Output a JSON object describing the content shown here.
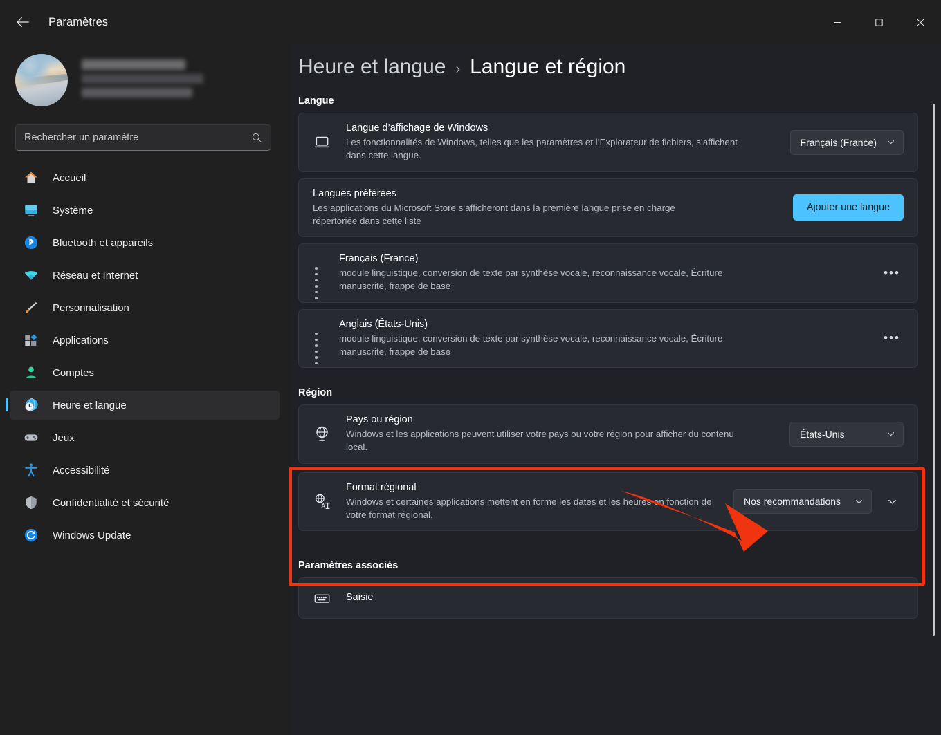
{
  "window": {
    "title": "Paramètres",
    "back_icon": "back-arrow-icon",
    "minimize_label": "—",
    "maximize_label": "□",
    "close_label": "✕"
  },
  "sidebar": {
    "account": {
      "avatar_icon": "user-avatar-image"
    },
    "search": {
      "placeholder": "Rechercher un paramètre",
      "value": "",
      "icon": "search-icon"
    },
    "items": [
      {
        "label": "Accueil",
        "icon": "home-icon",
        "active": false
      },
      {
        "label": "Système",
        "icon": "system-monitor-icon",
        "active": false
      },
      {
        "label": "Bluetooth et appareils",
        "icon": "bluetooth-icon",
        "active": false
      },
      {
        "label": "Réseau et Internet",
        "icon": "wifi-icon",
        "active": false
      },
      {
        "label": "Personnalisation",
        "icon": "paintbrush-icon",
        "active": false
      },
      {
        "label": "Applications",
        "icon": "apps-icon",
        "active": false
      },
      {
        "label": "Comptes",
        "icon": "person-icon",
        "active": false
      },
      {
        "label": "Heure et langue",
        "icon": "clock-globe-icon",
        "active": true
      },
      {
        "label": "Jeux",
        "icon": "gamepad-icon",
        "active": false
      },
      {
        "label": "Accessibilité",
        "icon": "accessibility-icon",
        "active": false
      },
      {
        "label": "Confidentialité et sécurité",
        "icon": "shield-icon",
        "active": false
      },
      {
        "label": "Windows Update",
        "icon": "update-refresh-icon",
        "active": false
      }
    ]
  },
  "breadcrumb": {
    "parent": "Heure et langue",
    "separator": "›",
    "current": "Langue et région"
  },
  "sections": {
    "language": {
      "title": "Langue",
      "display_language": {
        "icon": "laptop-icon",
        "heading": "Langue d’affichage de Windows",
        "description": "Les fonctionnalités de Windows, telles que les paramètres et l’Explorateur de fichiers, s’affichent dans cette langue.",
        "dropdown_value": "Français (France)"
      },
      "preferred": {
        "heading": "Langues préférées",
        "description": "Les applications du Microsoft Store s’afficheront dans la première langue prise en charge répertoriée dans cette liste",
        "button_label": "Ajouter une langue"
      },
      "list": [
        {
          "name": "Français (France)",
          "features": "module linguistique, conversion de texte par synthèse vocale, reconnaissance vocale, Écriture manuscrite, frappe de base",
          "more_label": "•••"
        },
        {
          "name": "Anglais (États-Unis)",
          "features": "module linguistique, conversion de texte par synthèse vocale, reconnaissance vocale, Écriture manuscrite, frappe de base",
          "more_label": "•••"
        }
      ]
    },
    "region": {
      "title": "Région",
      "country": {
        "icon": "globe-icon",
        "heading": "Pays ou région",
        "description": "Windows et les applications peuvent utiliser votre pays ou votre région pour afficher du contenu local.",
        "dropdown_value": "États-Unis"
      },
      "format": {
        "icon": "globe-translate-icon",
        "heading": "Format régional",
        "description": "Windows et certaines applications mettent en forme les dates et les heures en fonction de votre format régional.",
        "dropdown_value": "Nos recommandations"
      }
    },
    "related": {
      "title": "Paramètres associés",
      "items": [
        {
          "icon": "keyboard-icon",
          "heading": "Saisie"
        }
      ]
    }
  },
  "annotations": {
    "highlight_color": "#f0340f",
    "arrow_color": "#f0340f",
    "highlight_target": "region-section",
    "arrow_target": "country-dropdown"
  },
  "colors": {
    "accent": "#4cc2ff",
    "sidebar_bg": "#202020",
    "main_bg": "#1f2127",
    "card_bg": "#272a31"
  }
}
